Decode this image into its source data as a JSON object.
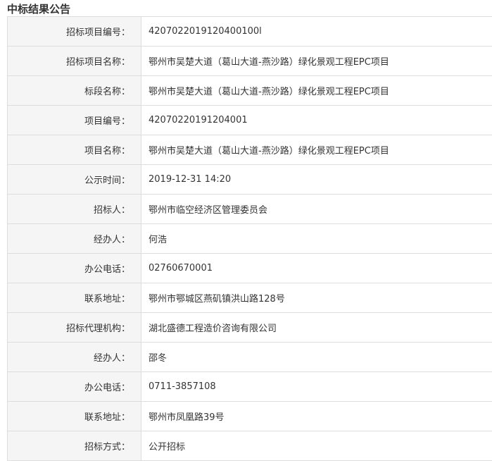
{
  "title": "中标结果公告",
  "rows": [
    {
      "label": "招标项目编号：",
      "value": "4207022019120400100l"
    },
    {
      "label": "招标项目名称：",
      "value": "鄂州市吴楚大道（葛山大道-燕沙路）绿化景观工程EPC项目"
    },
    {
      "label": "标段名称：",
      "value": "鄂州市吴楚大道（葛山大道-燕沙路）绿化景观工程EPC项目"
    },
    {
      "label": "项目编号：",
      "value": "42070220191204001"
    },
    {
      "label": "项目名称：",
      "value": "鄂州市吴楚大道（葛山大道-燕沙路）绿化景观工程EPC项目"
    },
    {
      "label": "公示时间：",
      "value": "2019-12-31 14:20"
    },
    {
      "label": "招标人：",
      "value": "鄂州市临空经济区管理委员会"
    },
    {
      "label": "经办人：",
      "value": "何浩"
    },
    {
      "label": "办公电话：",
      "value": "02760670001"
    },
    {
      "label": "联系地址：",
      "value": "鄂州市鄂城区燕矶镇洪山路128号"
    },
    {
      "label": "招标代理机构：",
      "value": "湖北盛德工程造价咨询有限公司"
    },
    {
      "label": "经办人：",
      "value": "邵冬"
    },
    {
      "label": "办公电话：",
      "value": "0711-3857108"
    },
    {
      "label": "联系地址：",
      "value": "鄂州市凤凰路39号"
    },
    {
      "label": "招标方式：",
      "value": "公开招标"
    }
  ]
}
